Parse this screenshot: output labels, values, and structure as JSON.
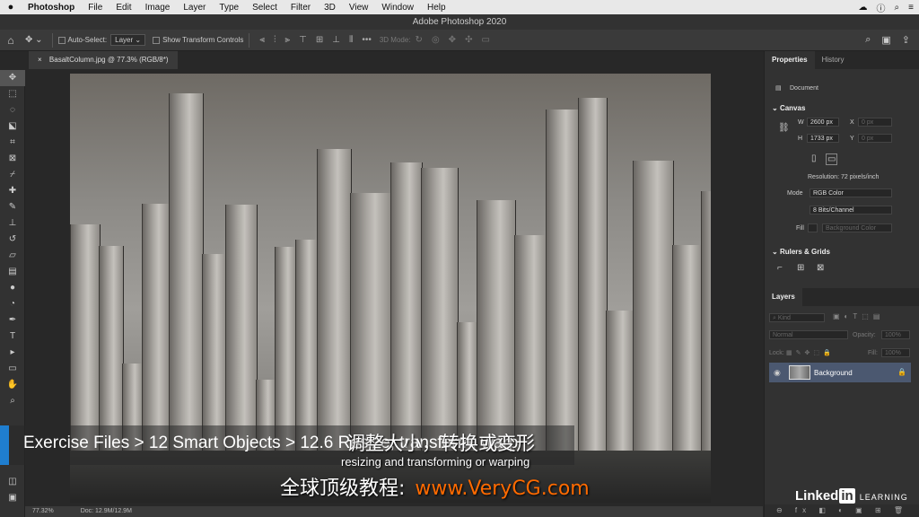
{
  "menubar": {
    "apple": "",
    "items": [
      "Photoshop",
      "File",
      "Edit",
      "Image",
      "Layer",
      "Type",
      "Select",
      "Filter",
      "3D",
      "View",
      "Window",
      "Help"
    ],
    "right_icons": [
      "creative-cloud-icon",
      "info-icon",
      "search-icon",
      "menu-icon"
    ]
  },
  "titlebar": {
    "title": "Adobe Photoshop 2020"
  },
  "options": {
    "home": "⌂",
    "move": "✥ ⌄",
    "auto_select": "Auto-Select:",
    "layer_select": "Layer ⌄",
    "show_transform": "Show Transform Controls",
    "more": "•••",
    "mode_3d": "3D Mode:"
  },
  "document": {
    "tab": "BasaltColumn.jpg @ 77.3% (RGB/8*)",
    "close": "×"
  },
  "status": {
    "zoom": "77.32%",
    "doc": "Doc: 12.9M/12.9M"
  },
  "properties": {
    "tabs": [
      "Properties",
      "History"
    ],
    "doc_label": "Document",
    "canvas_head": "Canvas",
    "w_label": "W",
    "w_value": "2600 px",
    "h_label": "H",
    "h_value": "1733 px",
    "x_label": "X",
    "x_value": "0 px",
    "y_label": "Y",
    "y_value": "0 px",
    "resolution": "Resolution: 72 pixels/inch",
    "mode_label": "Mode",
    "mode_value": "RGB Color",
    "bits_value": "8 Bits/Channel",
    "fill_label": "Fill",
    "fill_value": "Background Color",
    "rulers_head": "Rulers & Grids"
  },
  "layers": {
    "tab": "Layers",
    "kind": "Kind",
    "blend": "Normal",
    "opacity_label": "Opacity:",
    "opacity_value": "100%",
    "lock_label": "Lock:",
    "fill_label": "Fill:",
    "fill_value": "100%",
    "layer_name": "Background",
    "footer": "⊖ fx ◧ ◐ ▣ ⊞ 🗑"
  },
  "overlay": {
    "breadcrumb": "Exercise Files > 12 Smart Objects > 12.6 Resize, transform, warp",
    "subtitle_zh": "调整大小，转换或变形",
    "subtitle_en": "resizing and transforming or warping",
    "watermark_label": "全球顶级教程:",
    "watermark_url": "www.VeryCG.com",
    "brand_pre": "Linked",
    "brand_in": "in",
    "brand_learning": "LEARNING"
  },
  "colors": {
    "accent": "#1f7ecf",
    "watermark_url": "#ff6a00",
    "layer_selected": "#4b5870"
  }
}
